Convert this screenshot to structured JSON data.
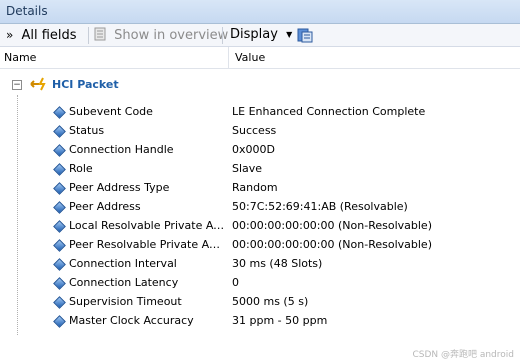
{
  "panel": {
    "title": "Details"
  },
  "toolbar": {
    "all_fields_label": "All fields",
    "show_overview_label": "Show in overview",
    "display_label": "Display"
  },
  "columns": {
    "name": "Name",
    "value": "Value"
  },
  "group": {
    "title": "HCI Packet"
  },
  "rows": [
    {
      "name": "Subevent Code",
      "value": "LE Enhanced Connection Complete"
    },
    {
      "name": "Status",
      "value": "Success"
    },
    {
      "name": "Connection Handle",
      "value": "0x000D"
    },
    {
      "name": "Role",
      "value": "Slave"
    },
    {
      "name": "Peer Address Type",
      "value": "Random"
    },
    {
      "name": "Peer Address",
      "value": "50:7C:52:69:41:AB (Resolvable)"
    },
    {
      "name": "Local Resolvable Private Addr…",
      "value": "00:00:00:00:00:00 (Non-Resolvable)"
    },
    {
      "name": "Peer Resolvable Private Addr…",
      "value": "00:00:00:00:00:00 (Non-Resolvable)"
    },
    {
      "name": "Connection Interval",
      "value": "30 ms (48 Slots)"
    },
    {
      "name": "Connection Latency",
      "value": "0"
    },
    {
      "name": "Supervision Timeout",
      "value": "5000 ms (5 s)"
    },
    {
      "name": "Master Clock Accuracy",
      "value": "31 ppm - 50 ppm"
    }
  ],
  "watermark": "CSDN @奔跑吧 android",
  "colors": {
    "group_title": "#1f5fa8",
    "title_bar": "#c6d9f1",
    "field_icon": "#1d5fb3"
  },
  "icons": {
    "all_fields": "double-chevron-down-icon",
    "show_overview": "document-icon",
    "display": "dropdown-arrow-icon",
    "export": "export-icon",
    "group": "hci-packet-icon",
    "field": "field-diamond-icon"
  }
}
